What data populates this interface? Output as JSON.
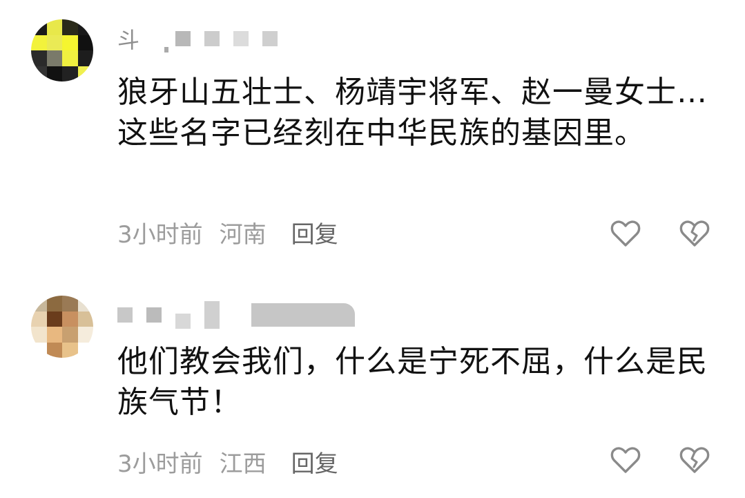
{
  "comments": [
    {
      "username_visible": "斗",
      "text": "狼牙山五壮士、杨靖宇将军、赵一曼女士…这些名字已经刻在中华民族的基因里。",
      "time": "3小时前",
      "location": "河南",
      "reply_label": "回复",
      "like_icon": "heart-outline-icon",
      "dislike_icon": "broken-heart-icon"
    },
    {
      "username_visible": "",
      "text": "他们教会我们，什么是宁死不屈，什么是民族气节！",
      "time": "3小时前",
      "location": "江西",
      "reply_label": "回复",
      "like_icon": "heart-outline-icon",
      "dislike_icon": "broken-heart-icon"
    }
  ],
  "colors": {
    "text": "#111111",
    "meta": "#9c9c9c",
    "reply": "#666666",
    "icon": "#8a8a8a"
  }
}
